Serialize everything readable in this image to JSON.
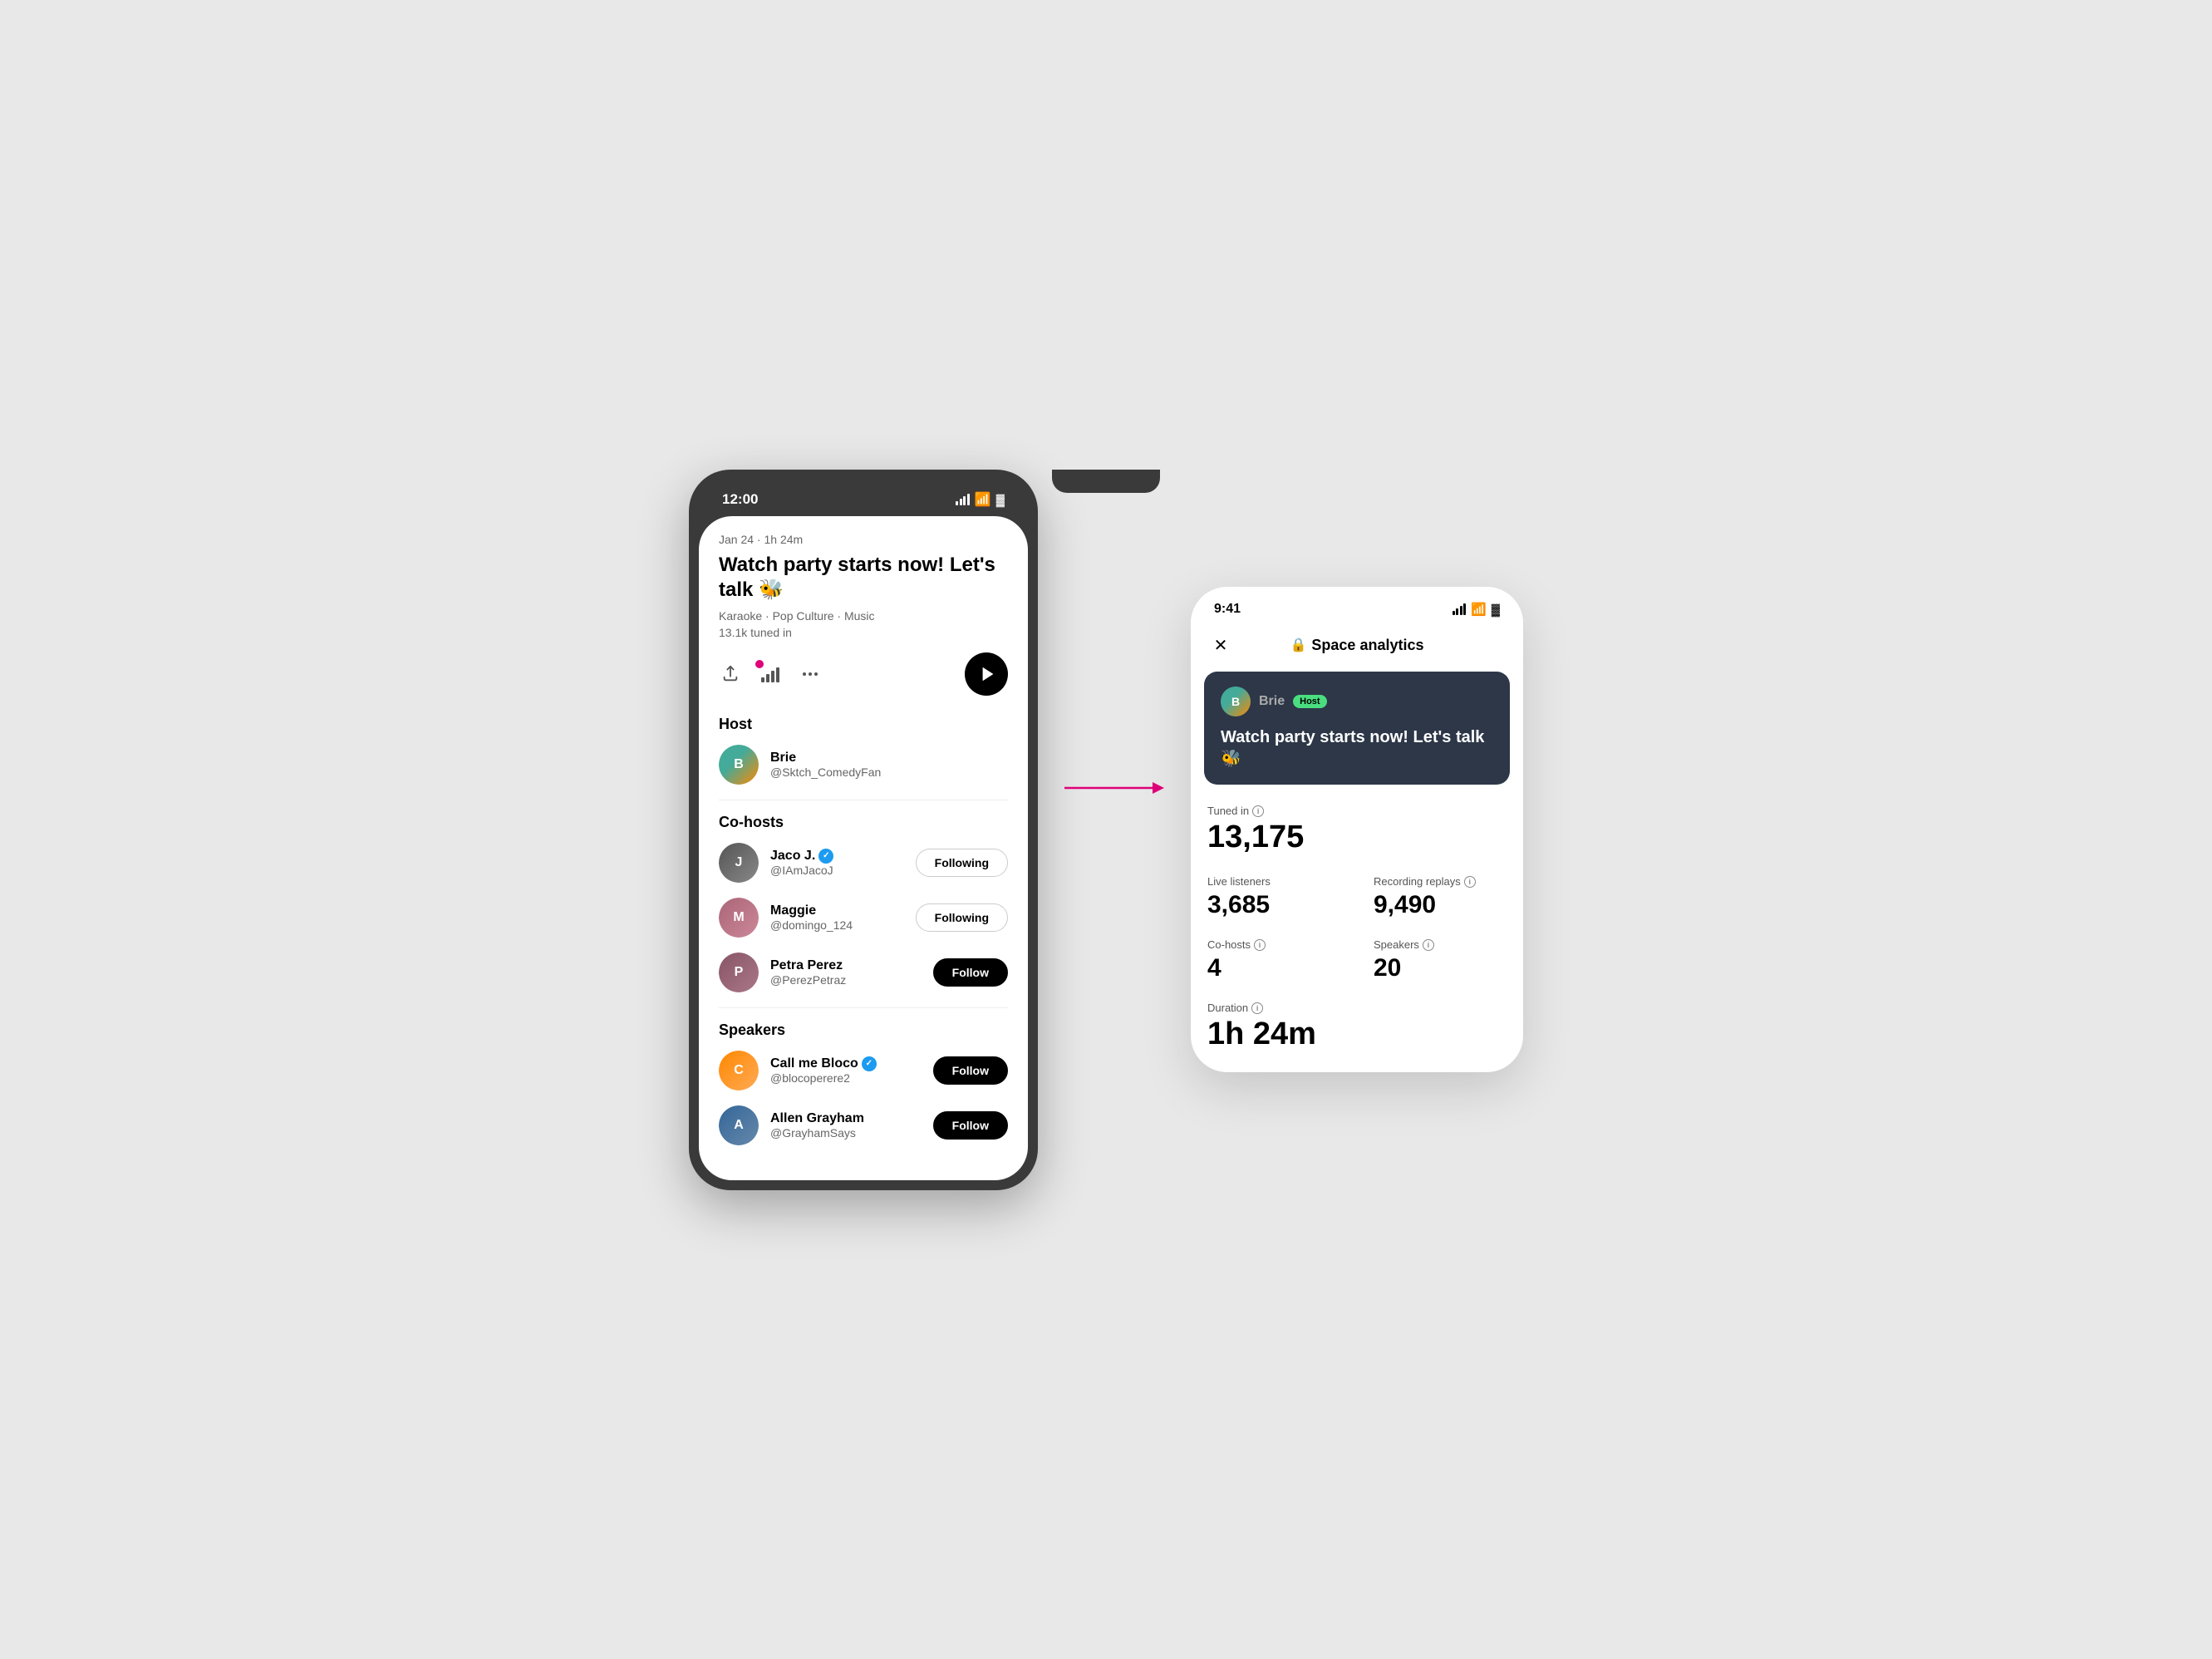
{
  "phone1": {
    "status": {
      "time": "12:00",
      "signal": "▐▐▐▐",
      "wifi": "WiFi",
      "battery": "🔋"
    },
    "post": {
      "meta": "Jan 24 · 1h 24m",
      "title": "Watch party starts now! Let's talk 🐝",
      "tags": "Karaoke · Pop Culture · Music",
      "tuned_in": "13.1k tuned in"
    },
    "host_label": "Host",
    "host": {
      "name": "Brie",
      "handle": "@Sktch_ComedyFan",
      "avatar_color": "#4a9"
    },
    "cohosts_label": "Co-hosts",
    "cohosts": [
      {
        "name": "Jaco J.",
        "handle": "@IAmJacoJ",
        "verified": true,
        "follow_state": "Following",
        "dark": false
      },
      {
        "name": "Maggie",
        "handle": "@domingo_124",
        "verified": false,
        "follow_state": "Following",
        "dark": false
      },
      {
        "name": "Petra Perez",
        "handle": "@PerezPetraz",
        "verified": false,
        "follow_state": "Follow",
        "dark": true
      }
    ],
    "speakers_label": "Speakers",
    "speakers": [
      {
        "name": "Call me Bloco",
        "handle": "@blocoperere2",
        "verified": true,
        "follow_state": "Follow",
        "dark": true
      },
      {
        "name": "Allen Grayham",
        "handle": "@GrayhamSays",
        "verified": false,
        "follow_state": "Follow",
        "dark": true
      }
    ]
  },
  "phone2": {
    "status": {
      "time": "9:41"
    },
    "header": {
      "title": "Space analytics",
      "close_label": "✕"
    },
    "space_card": {
      "host_name": "Brie",
      "host_badge": "Host",
      "title": "Watch party starts now! Let's talk 🐝"
    },
    "stats": {
      "tuned_in_label": "Tuned in",
      "tuned_in_value": "13,175",
      "live_listeners_label": "Live listeners",
      "live_listeners_value": "3,685",
      "recording_replays_label": "Recording replays",
      "recording_replays_value": "9,490",
      "cohosts_label": "Co-hosts",
      "cohosts_value": "4",
      "speakers_label": "Speakers",
      "speakers_value": "20",
      "duration_label": "Duration",
      "duration_value": "1h 24m"
    }
  }
}
